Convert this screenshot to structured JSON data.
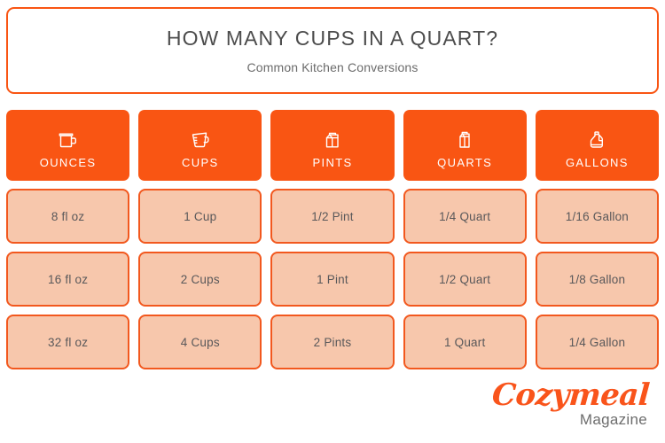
{
  "header": {
    "title": "HOW MANY CUPS IN A QUART?",
    "subtitle": "Common Kitchen Conversions"
  },
  "colors": {
    "orange": "#F95513",
    "cell_fill": "#F7C7AC",
    "cell_border": "#F2581E",
    "title_text": "#4c4c4c",
    "cell_text": "#59585a",
    "logo_orange": "#F9541B"
  },
  "table": {
    "columns": [
      {
        "label": "OUNCES",
        "icon": "measuring-pitcher-icon"
      },
      {
        "label": "CUPS",
        "icon": "measuring-cup-icon"
      },
      {
        "label": "PINTS",
        "icon": "pint-carton-icon"
      },
      {
        "label": "QUARTS",
        "icon": "quart-carton-icon"
      },
      {
        "label": "GALLONS",
        "icon": "gallon-jug-icon"
      }
    ],
    "rows": [
      [
        "8 fl oz",
        "1 Cup",
        "1/2 Pint",
        "1/4 Quart",
        "1/16 Gallon"
      ],
      [
        "16 fl oz",
        "2 Cups",
        "1 Pint",
        "1/2 Quart",
        "1/8 Gallon"
      ],
      [
        "32 fl oz",
        "4 Cups",
        "2 Pints",
        "1 Quart",
        "1/4 Gallon"
      ]
    ]
  },
  "logo": {
    "brand": "Cozymeal",
    "tagline": "Magazine"
  },
  "chart_data": {
    "type": "table",
    "title": "HOW MANY CUPS IN A QUART?",
    "subtitle": "Common Kitchen Conversions",
    "categories": [
      "OUNCES",
      "CUPS",
      "PINTS",
      "QUARTS",
      "GALLONS"
    ],
    "rows": [
      [
        "8 fl oz",
        "1 Cup",
        "1/2 Pint",
        "1/4 Quart",
        "1/16 Gallon"
      ],
      [
        "16 fl oz",
        "2 Cups",
        "1 Pint",
        "1/2 Quart",
        "1/8 Gallon"
      ],
      [
        "32 fl oz",
        "4 Cups",
        "2 Pints",
        "1 Quart",
        "1/4 Gallon"
      ]
    ]
  }
}
